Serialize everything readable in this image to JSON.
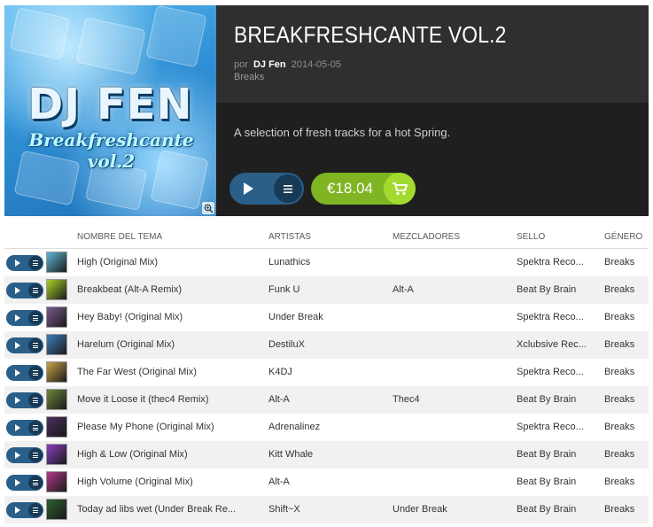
{
  "release": {
    "title": "BREAKFRESHCANTE VOL.2",
    "by_label": "por",
    "artist": "DJ Fen",
    "date": "2014-05-05",
    "genre": "Breaks",
    "description": "A selection of fresh tracks for a hot Spring.",
    "price": "€18.04",
    "cover_logo_text": "DJ FEN",
    "cover_subtitle": "Breakfreshcante vol.2"
  },
  "icons": {
    "play": "play-icon",
    "queue": "queue-list-icon",
    "cart": "shopping-cart-icon",
    "zoom": "zoom-magnifier-icon"
  },
  "colors": {
    "accent_blue": "#2a5f89",
    "price_green": "#7fb523",
    "cart_green": "#a3da2f"
  },
  "table": {
    "headers": {
      "title": "NOMBRE DEL TEMA",
      "artists": "ARTISTAS",
      "remixers": "MEZCLADORES",
      "label": "SELLO",
      "genre": "GÉNERO"
    },
    "rows": [
      {
        "title": "High (Original Mix)",
        "artists": "Lunathics",
        "remixers": "",
        "label": "Spektra Reco...",
        "genre": "Breaks"
      },
      {
        "title": "Breakbeat (Alt-A Remix)",
        "artists": "Funk U",
        "remixers": "Alt-A",
        "label": "Beat By Brain",
        "genre": "Breaks"
      },
      {
        "title": "Hey Baby! (Original Mix)",
        "artists": "Under Break",
        "remixers": "",
        "label": "Spektra Reco...",
        "genre": "Breaks"
      },
      {
        "title": "Harelum (Original Mix)",
        "artists": "DestiluX",
        "remixers": "",
        "label": "Xclubsive Rec...",
        "genre": "Breaks"
      },
      {
        "title": "The Far West (Original Mix)",
        "artists": "K4DJ",
        "remixers": "",
        "label": "Spektra Reco...",
        "genre": "Breaks"
      },
      {
        "title": "Move it Loose it (thec4 Remix)",
        "artists": "Alt-A",
        "remixers": "Thec4",
        "label": "Beat By Brain",
        "genre": "Breaks"
      },
      {
        "title": "Please My Phone (Original Mix)",
        "artists": "Adrenalinez",
        "remixers": "",
        "label": "Spektra Reco...",
        "genre": "Breaks"
      },
      {
        "title": "High & Low (Original Mix)",
        "artists": "Kitt Whale",
        "remixers": "",
        "label": "Beat By Brain",
        "genre": "Breaks"
      },
      {
        "title": "High Volume (Original Mix)",
        "artists": "Alt-A",
        "remixers": "",
        "label": "Beat By Brain",
        "genre": "Breaks"
      },
      {
        "title": "Today ad libs wet (Under Break Re...",
        "artists": "Shift~X",
        "remixers": "Under Break",
        "label": "Beat By Brain",
        "genre": "Breaks"
      }
    ]
  }
}
